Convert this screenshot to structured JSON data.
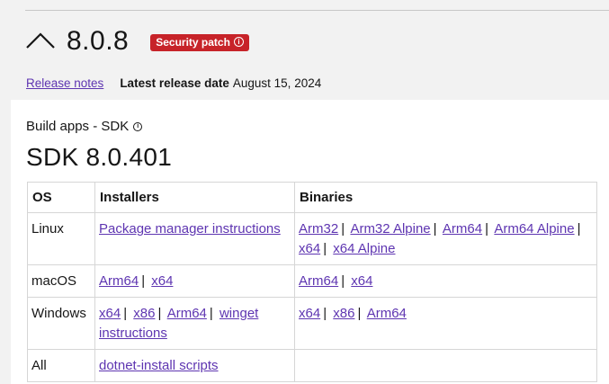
{
  "header": {
    "version": "8.0.8",
    "badge_label": "Security patch",
    "badge_color": "#c72329",
    "collapse_icon": "chevron-up-icon"
  },
  "meta": {
    "release_notes_link": "Release notes",
    "latest_release_label": "Latest release date",
    "latest_release_date": "August 15, 2024"
  },
  "sdk": {
    "section_label": "Build apps - SDK",
    "title": "SDK 8.0.401",
    "columns": [
      "OS",
      "Installers",
      "Binaries"
    ],
    "rows": [
      {
        "os": "Linux",
        "installers": [
          "Package manager instructions"
        ],
        "binaries": [
          "Arm32",
          "Arm32 Alpine",
          "Arm64",
          "Arm64 Alpine",
          "x64",
          "x64 Alpine"
        ]
      },
      {
        "os": "macOS",
        "installers": [
          "Arm64",
          "x64"
        ],
        "binaries": [
          "Arm64",
          "x64"
        ]
      },
      {
        "os": "Windows",
        "installers": [
          "x64",
          "x86",
          "Arm64",
          "winget instructions"
        ],
        "binaries": [
          "x64",
          "x86",
          "Arm64"
        ]
      },
      {
        "os": "All",
        "installers": [
          "dotnet-install scripts"
        ],
        "binaries": []
      }
    ]
  },
  "link_color": "#5e35b1"
}
